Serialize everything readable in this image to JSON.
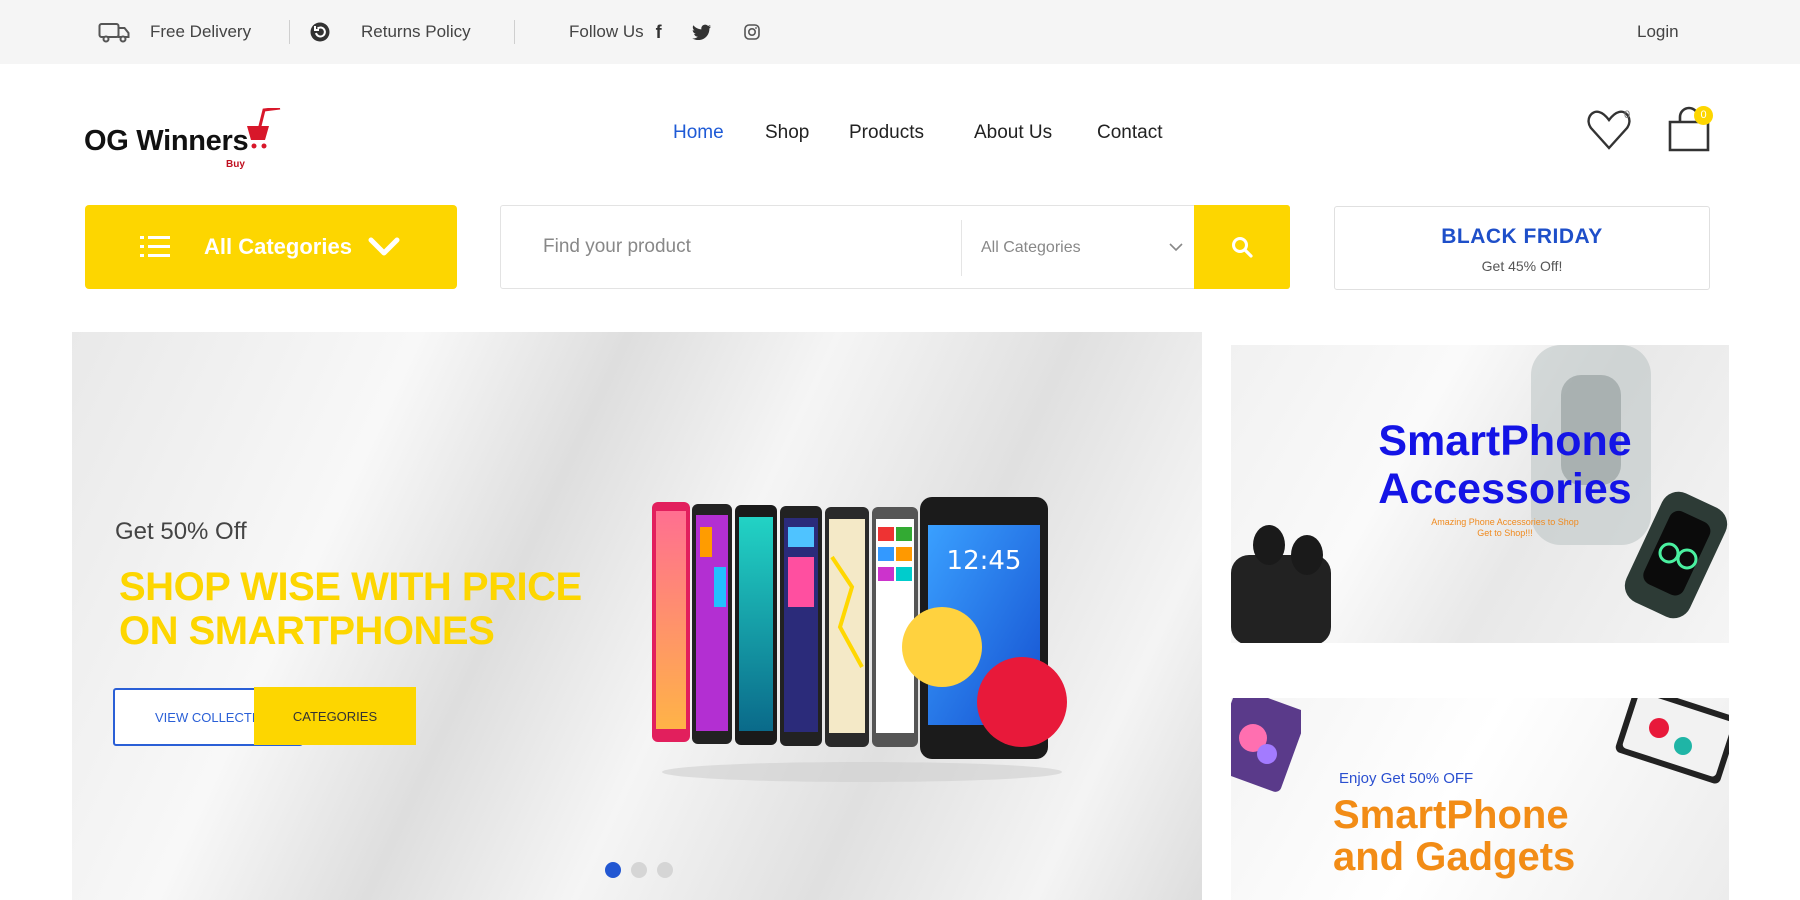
{
  "topbar": {
    "free_delivery": "Free Delivery",
    "returns_policy": "Returns Policy",
    "follow_us": "Follow Us",
    "login": "Login",
    "social_icons": [
      "facebook-icon",
      "twitter-icon",
      "instagram-icon"
    ]
  },
  "header": {
    "logo_text": "OG Winners",
    "logo_subtext": "Buy",
    "nav": [
      "Home",
      "Shop",
      "Products",
      "About Us",
      "Contact"
    ],
    "active_nav": "Home",
    "wishlist_count": "0",
    "cart_count": "0"
  },
  "category_button": {
    "label": "All Categories"
  },
  "search": {
    "placeholder": "Find your product",
    "category_select": "All Categories"
  },
  "promo": {
    "title": "BLACK FRIDAY",
    "subtitle": "Get 45% Off!"
  },
  "hero": {
    "sub": "Get 50% Off",
    "headline_line1": "SHOP WISE WITH PRICE",
    "headline_line2": "ON SMARTPHONES",
    "button_view": "VIEW COLLECTION",
    "button_categories": "CATEGORIES",
    "phone_clock": "12:45",
    "slides": 3,
    "active_slide": 1
  },
  "banner_accessories": {
    "title_line1": "SmartPhone",
    "title_line2": "Accessories",
    "note_line1": "Amazing Phone Accessories to Shop",
    "note_line2": "Get to Shop!!!"
  },
  "banner_gadgets": {
    "kicker": "Enjoy Get 50% OFF",
    "title_line1": "SmartPhone",
    "title_line2": "and Gadgets"
  },
  "colors": {
    "brand_yellow": "#fdd600",
    "brand_blue": "#1e5ad6",
    "accent_orange": "#f28c16"
  }
}
